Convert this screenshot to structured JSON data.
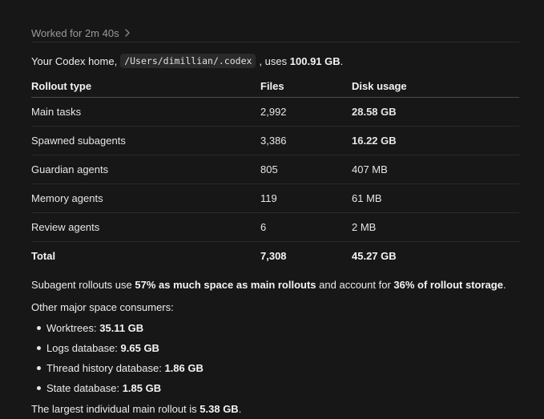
{
  "worked": {
    "label": "Worked for 2m 40s"
  },
  "intro": {
    "prefix": "Your Codex home,",
    "path": "/Users/dimillian/.codex",
    "middle": ", uses",
    "size": "100.91 GB",
    "suffix": "."
  },
  "table": {
    "headers": [
      "Rollout type",
      "Files",
      "Disk usage"
    ],
    "rows": [
      {
        "type": "Main tasks",
        "files": "2,992",
        "disk": "28.58 GB",
        "bold_disk": true
      },
      {
        "type": "Spawned subagents",
        "files": "3,386",
        "disk": "16.22 GB",
        "bold_disk": true
      },
      {
        "type": "Guardian agents",
        "files": "805",
        "disk": "407 MB",
        "bold_disk": false
      },
      {
        "type": "Memory agents",
        "files": "119",
        "disk": "61 MB",
        "bold_disk": false
      },
      {
        "type": "Review agents",
        "files": "6",
        "disk": "2 MB",
        "bold_disk": false
      }
    ],
    "total": {
      "type": "Total",
      "files": "7,308",
      "disk": "45.27 GB"
    }
  },
  "summary": {
    "p1": "Subagent rollouts use",
    "b1": "57% as much space as main rollouts",
    "p2": "and account for",
    "b2": "36% of rollout storage",
    "p3": "."
  },
  "other": {
    "label": "Other major space consumers:"
  },
  "consumers": [
    {
      "label": "Worktrees:",
      "value": "35.11 GB"
    },
    {
      "label": "Logs database:",
      "value": "9.65 GB"
    },
    {
      "label": "Thread history database:",
      "value": "1.86 GB"
    },
    {
      "label": "State database:",
      "value": "1.85 GB"
    }
  ],
  "largest": {
    "prefix": "The largest individual main rollout is",
    "value": "5.38 GB",
    "suffix": "."
  }
}
